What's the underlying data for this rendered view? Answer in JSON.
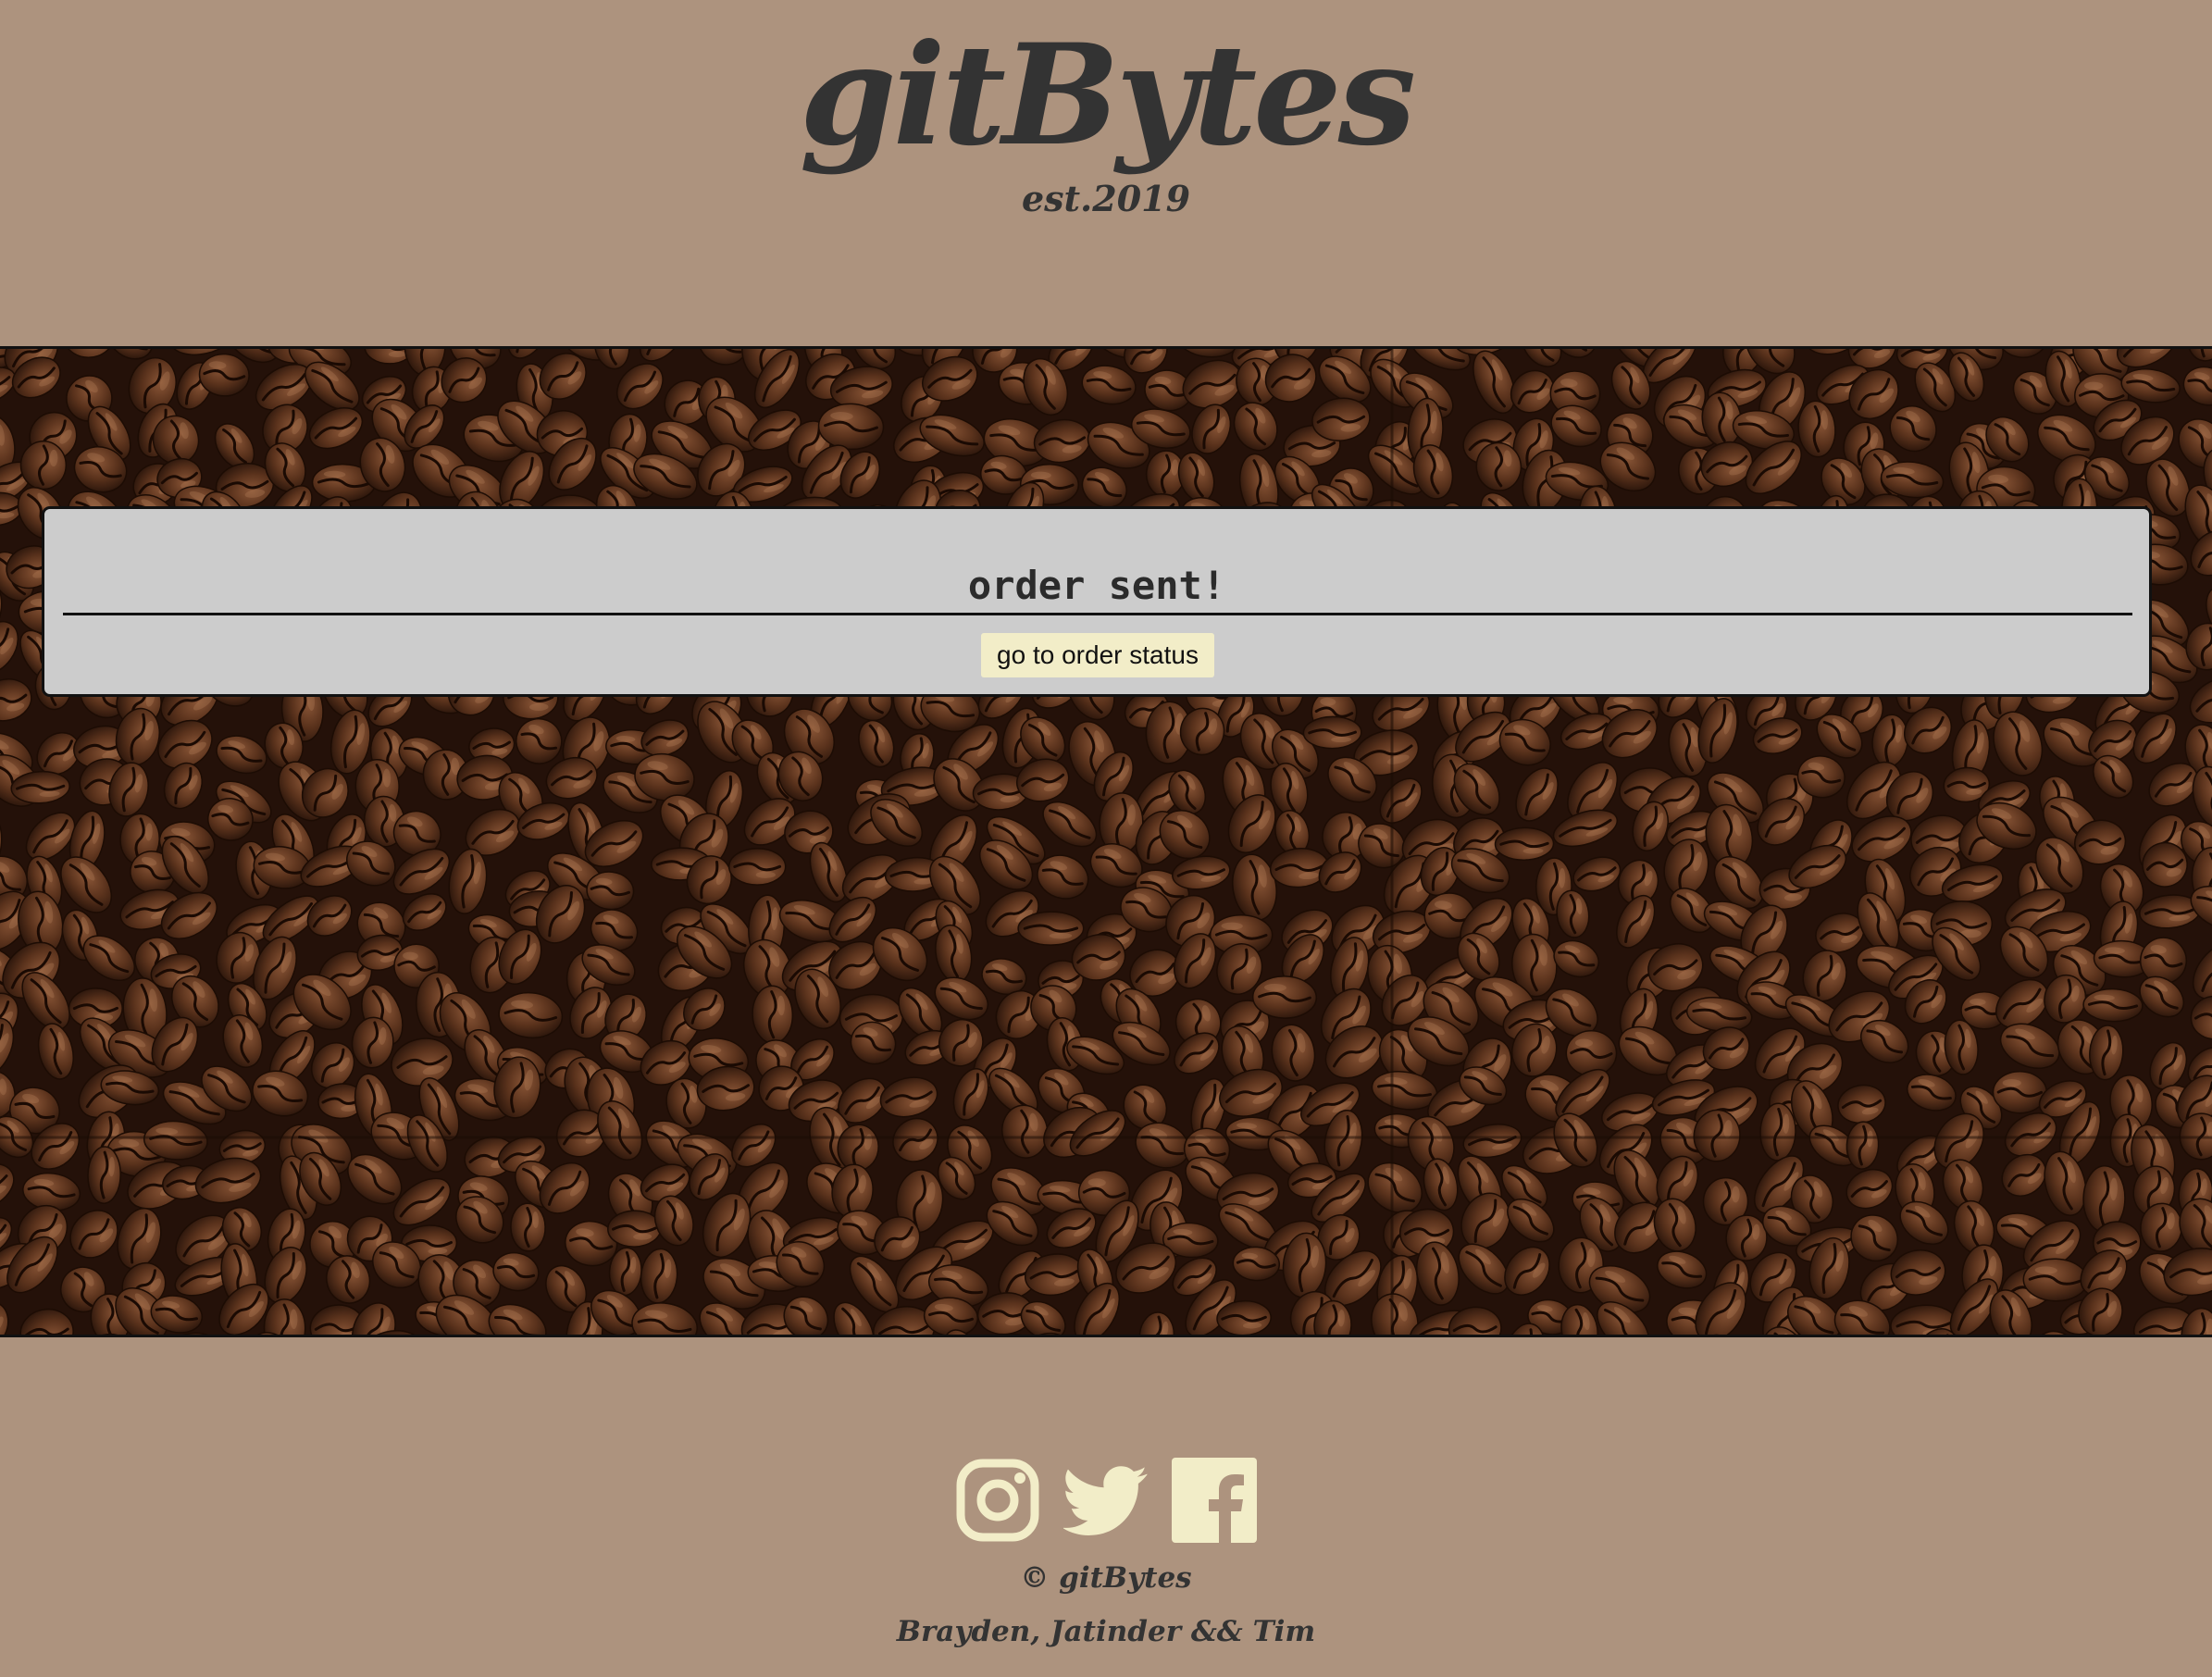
{
  "header": {
    "logo": "gitBytes",
    "established": "est.2019"
  },
  "order_panel": {
    "message": "order sent!",
    "button_label": "go to order status"
  },
  "footer": {
    "social_icons": [
      "instagram-icon",
      "twitter-icon",
      "facebook-icon"
    ],
    "copyright": "© gitBytes",
    "authors": "Brayden, Jatinder && Tim"
  },
  "colors": {
    "page_background": "#ad937e",
    "panel_background": "#cccccc",
    "button_background": "#f2edc8",
    "icon_color": "#f2edc8",
    "text_dark": "#333333",
    "coffee_dark": "#2a160c",
    "coffee_bean": "#6b3f27"
  }
}
